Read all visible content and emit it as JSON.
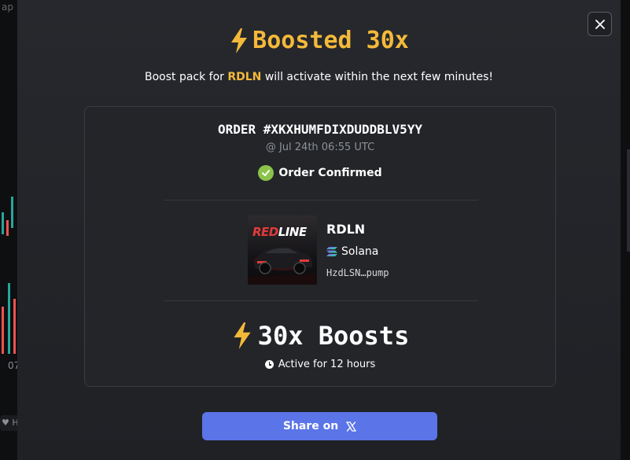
{
  "background": {
    "topbar_text": "ap · ·· f",
    "axis_label": "07",
    "bottom_chip_label": "H"
  },
  "modal": {
    "close_icon": "close-icon",
    "title_icon": "lightning-bolt-icon",
    "title": "Boosted 30x",
    "subtitle_prefix": "Boost pack for ",
    "subtitle_token": "RDLN",
    "subtitle_suffix": " will activate within the next few minutes!",
    "order": {
      "id": "ORDER #XKXHUMFDIXDUDDBLV5YY",
      "timestamp": "@ Jul 24th 06:55 UTC",
      "status": "Order Confirmed",
      "status_icon": "check-circle-icon"
    },
    "token": {
      "image_text": "REDLINE",
      "symbol": "RDLN",
      "chain": "Solana",
      "chain_icon": "solana-icon",
      "address": "HzdLSN…pump"
    },
    "boost": {
      "icon": "lightning-bolt-icon",
      "label": "30x Boosts",
      "duration": "Active for 12 hours",
      "duration_icon": "clock-icon"
    },
    "share": {
      "label": "Share on",
      "icon": "x-logo-icon"
    }
  },
  "colors": {
    "accent_gold": "#f4b93a",
    "confirm_green": "#8bc34a",
    "share_blue": "#5b74e8",
    "token_red": "#e23b3b"
  }
}
